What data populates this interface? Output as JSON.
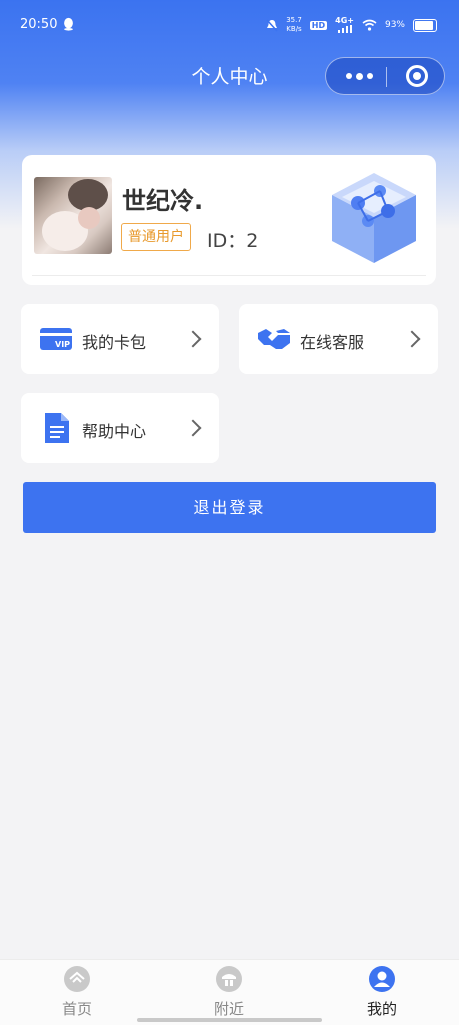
{
  "status_bar": {
    "time": "20:50",
    "net_speed": "35.7",
    "net_unit": "KB/s",
    "hd": "HD",
    "network": "4G+",
    "battery": "93%"
  },
  "header": {
    "title": "个人中心"
  },
  "profile": {
    "username": "世纪冷.",
    "badge": "普通用户",
    "id_text": "ID：2"
  },
  "menu": [
    {
      "label": "我的卡包",
      "icon": "vip-card-icon"
    },
    {
      "label": "在线客服",
      "icon": "handshake-icon"
    },
    {
      "label": "帮助中心",
      "icon": "document-icon"
    }
  ],
  "logout_label": "退出登录",
  "tabs": [
    {
      "label": "首页",
      "icon": "home-icon",
      "active": false
    },
    {
      "label": "附近",
      "icon": "nearby-icon",
      "active": false
    },
    {
      "label": "我的",
      "icon": "user-icon",
      "active": true
    }
  ],
  "colors": {
    "accent": "#3d73f0",
    "badge": "#e89a2d"
  }
}
